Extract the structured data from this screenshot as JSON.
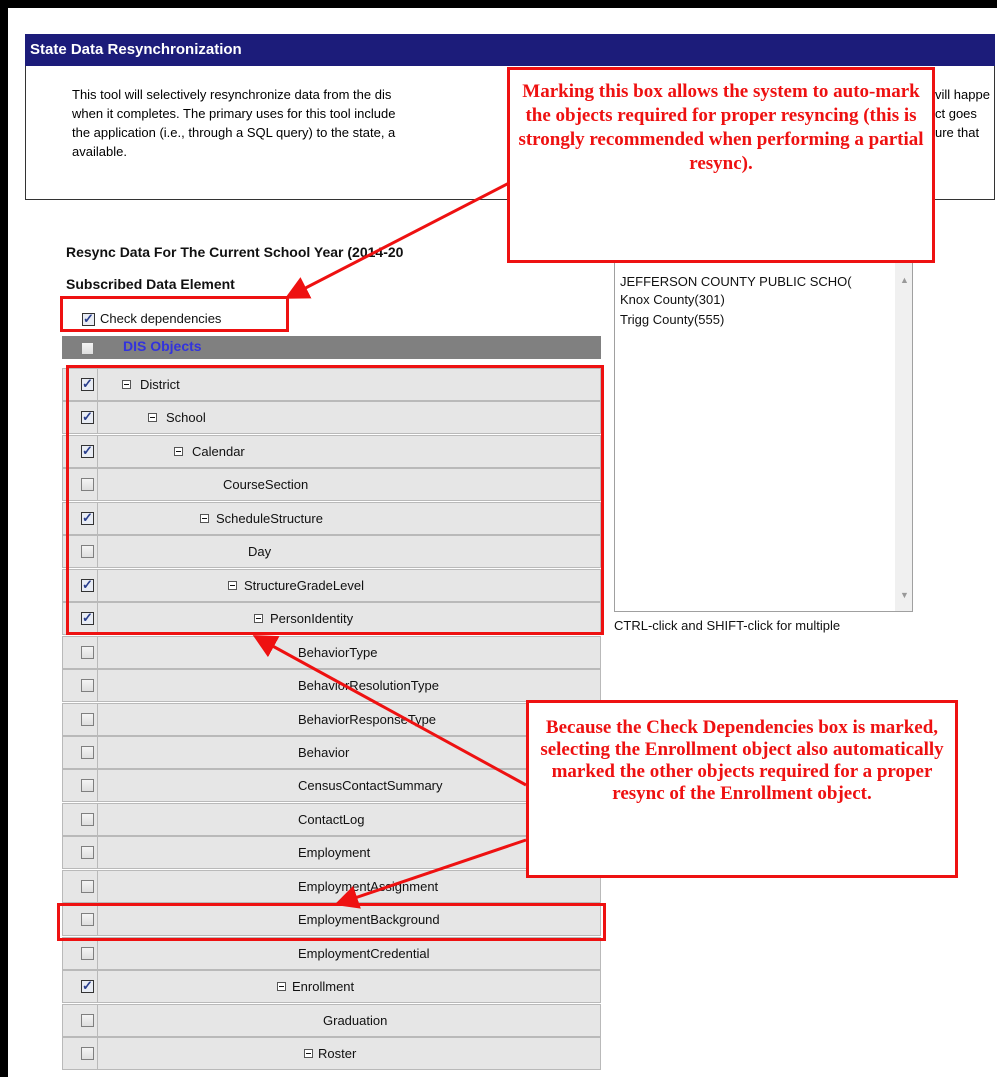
{
  "header": {
    "title": "State Data Resynchronization"
  },
  "description": "This tool will selectively resynchronize data from the dis... will happen when it completes. The primary uses for this tool include ...ct goes the application (i.e., through a SQL query) to the state, a ...ure that available.",
  "description_lines": [
    "This tool will selectively resynchronize data from the dis",
    "when it completes. The primary uses for this tool include",
    "the application (i.e., through a SQL query) to the state, a",
    "available."
  ],
  "description_right_lines": [
    "vill happe",
    "ct goes",
    "ure that"
  ],
  "resync_title": "Resync Data For The Current School Year (2014-20",
  "subscribed_label": "Subscribed Data Element",
  "check_dependencies": {
    "label": "Check dependencies",
    "checked": true
  },
  "tree_header": {
    "label": "DIS Objects",
    "checked": false
  },
  "tree_rows": [
    {
      "label": "District",
      "checked": true,
      "expandable": true
    },
    {
      "label": "School",
      "checked": true,
      "expandable": true
    },
    {
      "label": "Calendar",
      "checked": true,
      "expandable": true
    },
    {
      "label": "CourseSection",
      "checked": false,
      "expandable": false
    },
    {
      "label": "ScheduleStructure",
      "checked": true,
      "expandable": true
    },
    {
      "label": "Day",
      "checked": false,
      "expandable": false
    },
    {
      "label": "StructureGradeLevel",
      "checked": true,
      "expandable": true
    },
    {
      "label": "PersonIdentity",
      "checked": true,
      "expandable": true
    },
    {
      "label": "BehaviorType",
      "checked": false,
      "expandable": false
    },
    {
      "label": "BehaviorResolutionType",
      "checked": false,
      "expandable": false
    },
    {
      "label": "BehaviorResponseType",
      "checked": false,
      "expandable": false
    },
    {
      "label": "Behavior",
      "checked": false,
      "expandable": false
    },
    {
      "label": "CensusContactSummary",
      "checked": false,
      "expandable": false
    },
    {
      "label": "ContactLog",
      "checked": false,
      "expandable": false
    },
    {
      "label": "Employment",
      "checked": false,
      "expandable": false
    },
    {
      "label": "EmploymentAssignment",
      "checked": false,
      "expandable": false
    },
    {
      "label": "EmploymentBackground",
      "checked": false,
      "expandable": false
    },
    {
      "label": "EmploymentCredential",
      "checked": false,
      "expandable": false
    },
    {
      "label": "Enrollment",
      "checked": true,
      "expandable": true
    },
    {
      "label": "Graduation",
      "checked": false,
      "expandable": false
    },
    {
      "label": "Roster",
      "checked": false,
      "expandable": true
    }
  ],
  "district_list": {
    "items": [
      "JEFFERSON COUNTY PUBLIC SCHO(",
      "Knox County(301)",
      "Trigg County(555)"
    ],
    "help": "CTRL-click and SHIFT-click for multiple"
  },
  "callouts": {
    "top": "Marking this box allows the system to auto-mark the objects required for proper resyncing (this is strongly recommended when performing a partial resync).",
    "bottom": "Because the Check Dependencies box is marked, selecting the Enrollment object also automatically marked the other objects required for a proper resync of the Enrollment object."
  },
  "colors": {
    "header_bg": "#1c1c7a",
    "annotation_red": "#ee1111",
    "tree_header_bg": "#808080",
    "tree_header_text": "#3333dd",
    "row_bg": "#e6e6e6"
  }
}
